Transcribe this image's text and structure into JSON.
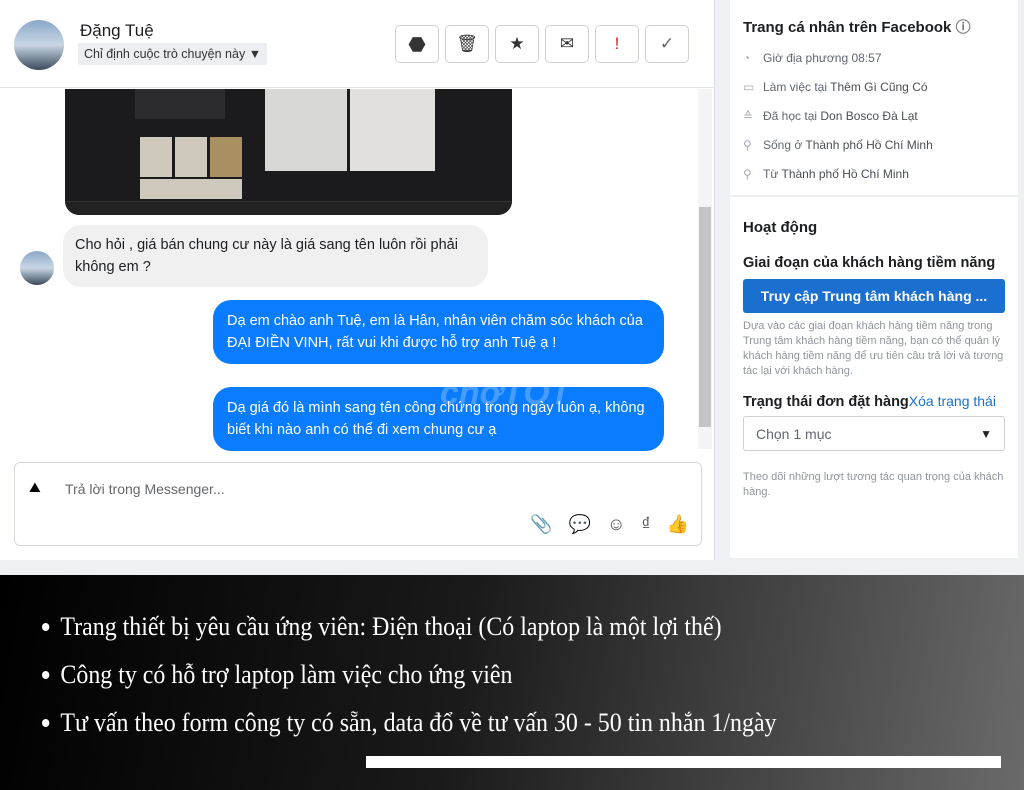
{
  "header": {
    "name": "Đặng Tuệ",
    "assign_label": "Chỉ định cuộc trò chuyện này",
    "actions": [
      {
        "icon": "alert-octagon-icon",
        "glyph": "⬣"
      },
      {
        "icon": "trash-icon",
        "glyph": "🗑"
      },
      {
        "icon": "star-icon",
        "glyph": "★"
      },
      {
        "icon": "mail-icon",
        "glyph": "✉"
      },
      {
        "icon": "exclamation-icon",
        "glyph": "!"
      },
      {
        "icon": "check-icon",
        "glyph": "✓"
      }
    ]
  },
  "messages": [
    {
      "dir": "in",
      "text": "Cho hỏi , giá bán chung cư này là giá sang tên luôn rồi phải không em ?"
    },
    {
      "dir": "out",
      "text": "Dạ em chào anh Tuệ, em là Hân, nhân viên chăm sóc khách của ĐẠI ĐIỀN VINH, rất vui khi được hỗ trợ anh Tuệ ạ !"
    },
    {
      "dir": "out",
      "text": "Dạ giá đó là mình sang tên công chứng trong ngày luôn ạ, không biết khi nào anh có thể đi xem chung cư ạ"
    }
  ],
  "composer": {
    "placeholder": "Trả lời trong Messenger..."
  },
  "profile": {
    "title": "Trang cá nhân trên Facebook",
    "items": [
      {
        "label": "Giờ địa phương 08:57",
        "value": ""
      },
      {
        "label": "Làm việc tại ",
        "value": "Thêm Gì Cũng Có"
      },
      {
        "label": "Đã học tại ",
        "value": "Don Bosco Đà Lạt"
      },
      {
        "label": "Sống ở ",
        "value": "Thành phố Hồ Chí Minh"
      },
      {
        "label": "Từ ",
        "value": "Thành phố Hồ Chí Minh"
      }
    ]
  },
  "activity": {
    "title": "Hoạt động",
    "stage_title": "Giai đoạn của khách hàng tiềm năng",
    "cta": "Truy cập Trung tâm khách hàng ...",
    "stage_desc": "Dựa vào các giai đoạn khách hàng tiềm năng trong Trung tâm khách hàng tiềm năng, bạn có thể quản lý khách hàng tiềm năng để ưu tiên câu trả lời và tương tác lại với khách hàng.",
    "order_title": "Trạng thái đơn đặt hàng",
    "clear_link": "Xóa trạng thái",
    "select_value": "Chọn 1 mục",
    "order_desc": "Theo dõi những lượt tương tác quan trọng của khách hàng."
  },
  "bullets": [
    "Trang thiết bị yêu cầu ứng viên: Điện thoại (Có laptop là một lợi thế)",
    "Công ty có hỗ trợ laptop làm việc cho ứng viên",
    "Tư vấn theo form công ty có sẵn, data đổ về tư vấn 30 - 50 tin nhắn 1/ngày"
  ],
  "watermark": "chợTỐT",
  "colors": {
    "accent": "#0a7cff",
    "cta": "#1a6fcf"
  }
}
